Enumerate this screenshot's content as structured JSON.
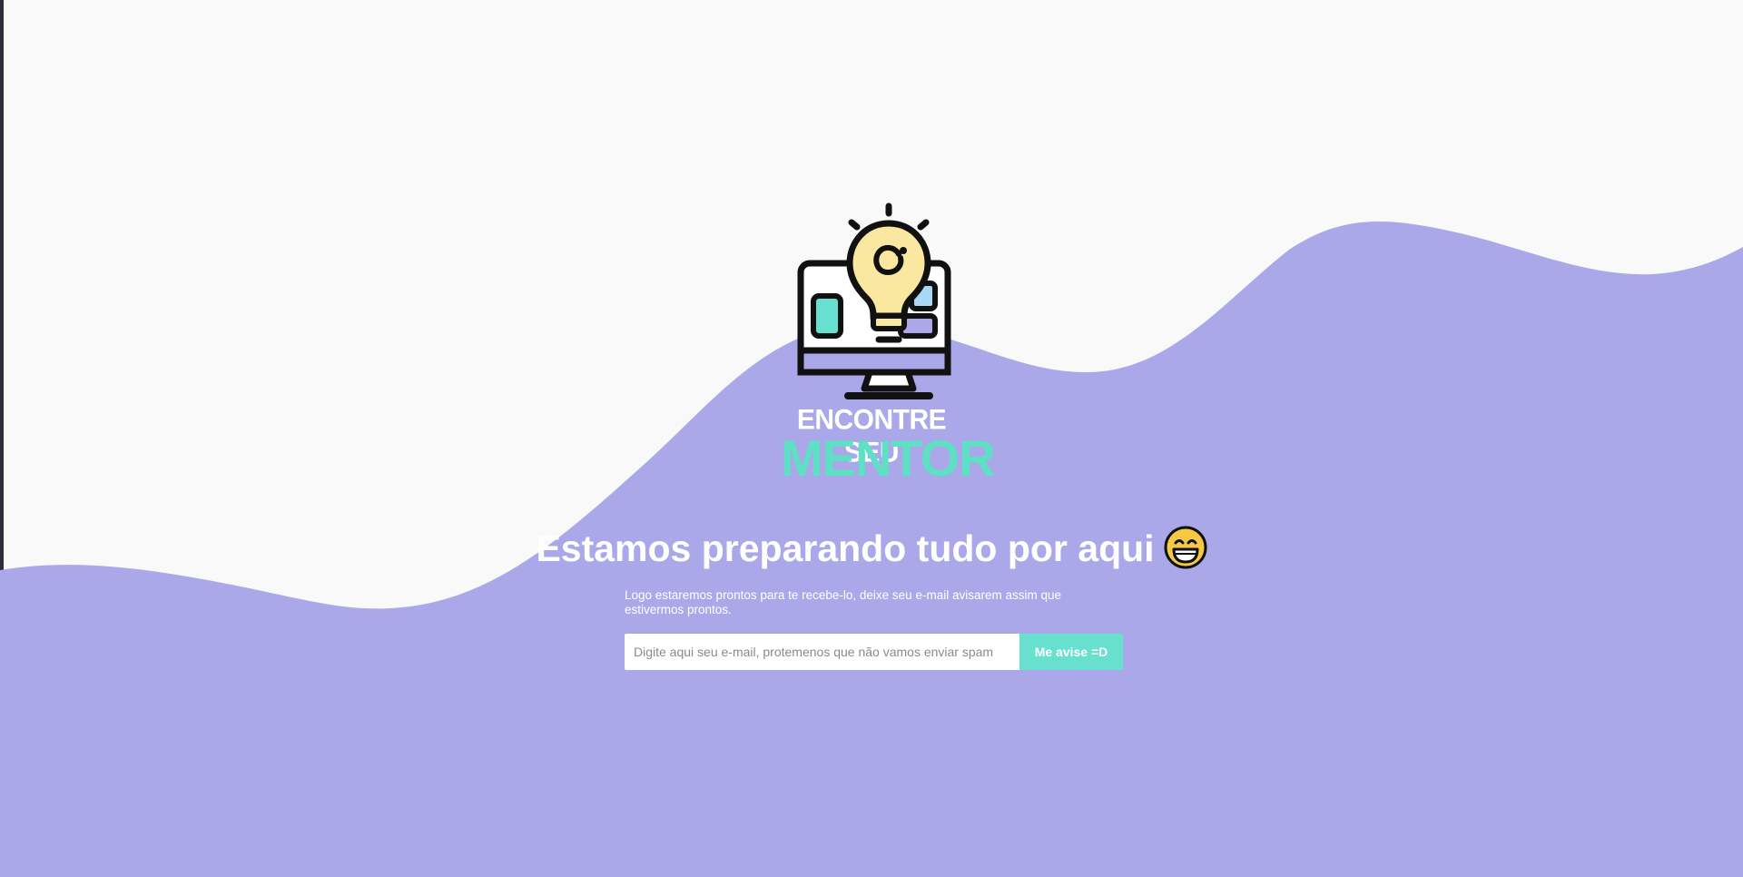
{
  "colors": {
    "background": "#f9f9f9",
    "wave": "#aaa8e9",
    "accent_mint": "#68e0cf",
    "brand_mint": "#5de0c4",
    "text_white": "#ffffff"
  },
  "logo": {
    "icon": "monitor-lightbulb-icon",
    "line1": "ENCONTRE SEU",
    "line2": "MENTOR"
  },
  "hero": {
    "headline": "Estamos preparando tudo por aqui",
    "emoji": "grinning-face-icon",
    "subtitle": "Logo estaremos prontos para te recebe-lo, deixe seu e-mail avisarem assim que estivermos prontos."
  },
  "signup": {
    "email_placeholder": "Digite aqui seu e-mail, protemenos que não vamos enviar spam",
    "email_value": "",
    "button_label": "Me avise =D"
  }
}
